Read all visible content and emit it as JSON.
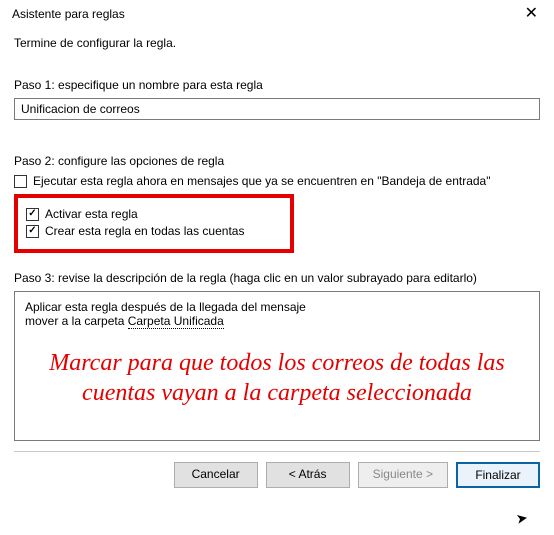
{
  "title": "Asistente para reglas",
  "instruction": "Termine de configurar la regla.",
  "step1": {
    "label": "Paso 1: especifique un nombre para esta regla",
    "value": "Unificacion de correos"
  },
  "step2": {
    "label": "Paso 2: configure las opciones de regla",
    "run_now": "Ejecutar esta regla ahora en mensajes que ya se encuentren en \"Bandeja de entrada\"",
    "activate": "Activar esta regla",
    "all_accounts": "Crear esta regla en todas las cuentas"
  },
  "step3": {
    "label": "Paso 3: revise la descripción de la regla (haga clic en un valor subrayado para editarlo)",
    "line1": "Aplicar esta regla después de la llegada del mensaje",
    "line2_prefix": "mover a la carpeta ",
    "line2_link": "Carpeta Unificada"
  },
  "annotation": "Marcar para que todos los correos de todas las cuentas vayan a la carpeta seleccionada",
  "buttons": {
    "cancel": "Cancelar",
    "back": "< Atrás",
    "next": "Siguiente >",
    "finish": "Finalizar"
  }
}
